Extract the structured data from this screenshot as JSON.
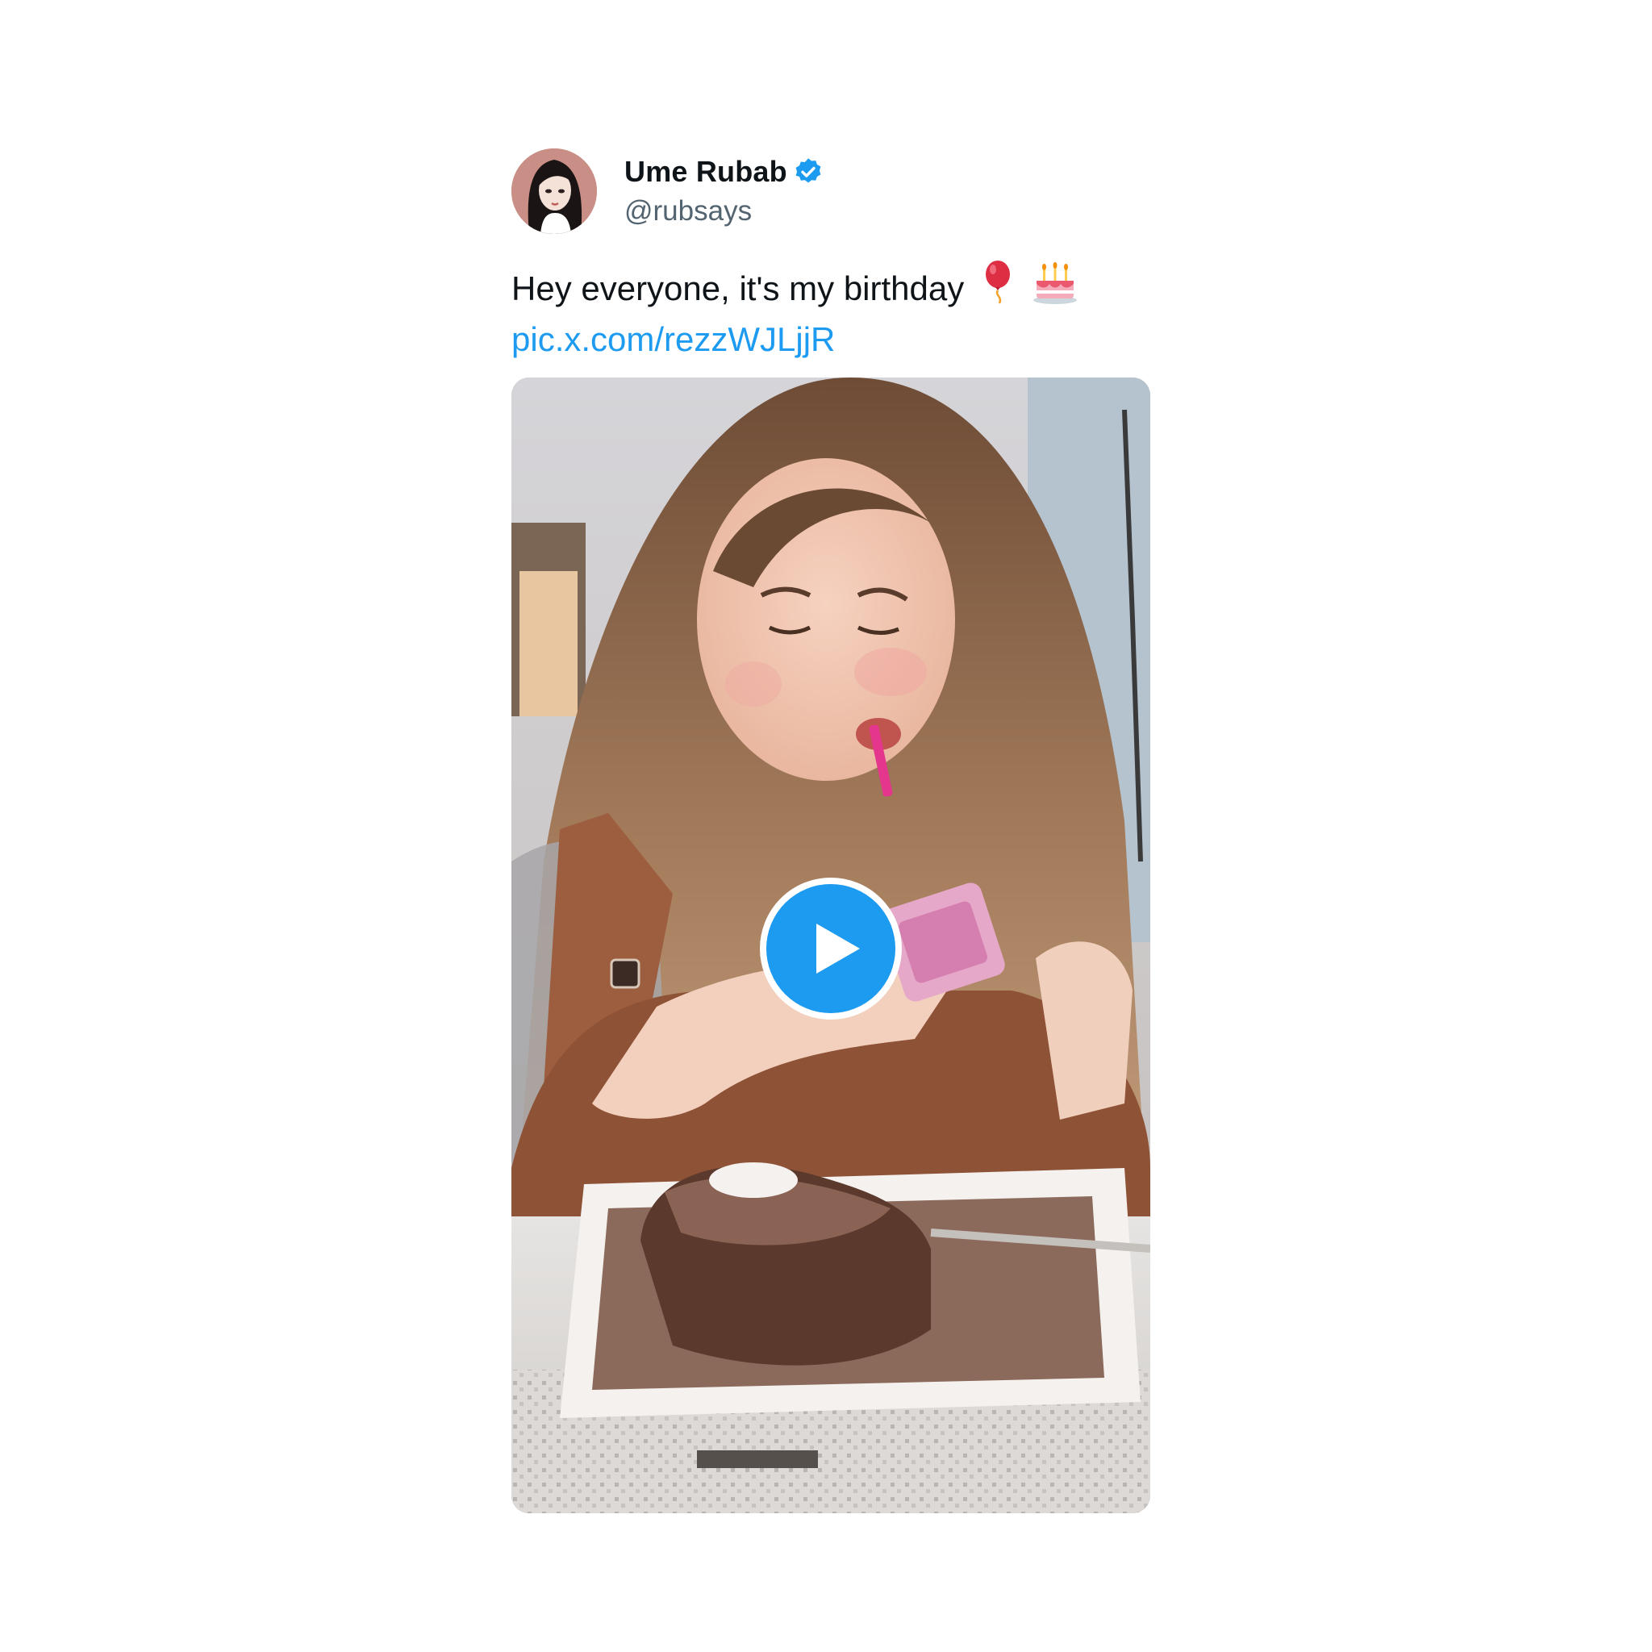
{
  "tweet": {
    "author": {
      "display_name": "Ume Rubab",
      "handle": "@rubsays",
      "verified_icon": "verified-badge-icon",
      "avatar_icon": "profile-avatar"
    },
    "text": "Hey everyone, it's my birthday",
    "emojis": [
      "balloon-emoji",
      "birthday-cake-emoji"
    ],
    "link": "pic.x.com/rezzWJLjjR",
    "media": {
      "type": "video",
      "play_icon": "play-icon"
    }
  },
  "colors": {
    "accent": "#1d9bf0",
    "text_primary": "#0f1419",
    "text_secondary": "#536471",
    "background": "#ffffff"
  }
}
